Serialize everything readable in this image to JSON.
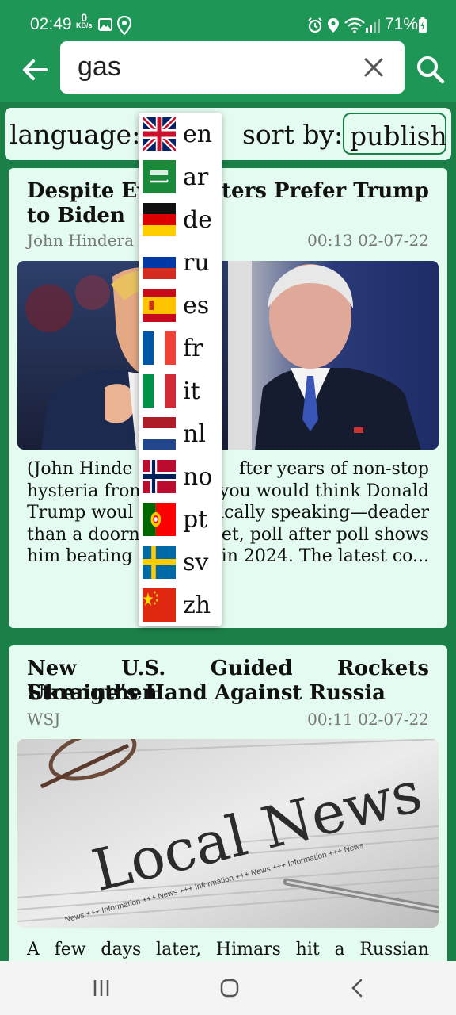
{
  "status_bar": {
    "time": "02:49",
    "net_speed_value": "0",
    "net_speed_unit": "KB/s",
    "battery": "71%",
    "icons": [
      "image-icon",
      "location-icon",
      "alarm-icon",
      "location-icon",
      "wifi-icon",
      "signal-icon",
      "battery-icon"
    ]
  },
  "header": {
    "search_value": "gas",
    "icons": {
      "back": "arrow-left-icon",
      "clear": "close-icon",
      "search": "search-icon"
    }
  },
  "filters": {
    "language_label": "language:",
    "sort_label": "sort by:",
    "sort_value": "publish"
  },
  "language_dropdown": {
    "items": [
      {
        "code": "en",
        "flag": "uk-flag-icon"
      },
      {
        "code": "ar",
        "flag": "saudi-arabia-flag-icon"
      },
      {
        "code": "de",
        "flag": "germany-flag-icon"
      },
      {
        "code": "ru",
        "flag": "russia-flag-icon"
      },
      {
        "code": "es",
        "flag": "spain-flag-icon"
      },
      {
        "code": "fr",
        "flag": "france-flag-icon"
      },
      {
        "code": "it",
        "flag": "italy-flag-icon"
      },
      {
        "code": "nl",
        "flag": "netherlands-flag-icon"
      },
      {
        "code": "no",
        "flag": "norway-flag-icon"
      },
      {
        "code": "pt",
        "flag": "portugal-flag-icon"
      },
      {
        "code": "sv",
        "flag": "sweden-flag-icon"
      },
      {
        "code": "zh",
        "flag": "china-flag-icon"
      }
    ]
  },
  "articles": [
    {
      "title_line1": "Despite Eve",
      "title_line1_right": "Voters Prefer Trump",
      "title_line2": "to Biden",
      "source": "John Hindera",
      "date": "00:13 02-07-22",
      "desc_lines": [
        [
          "(John Hinde",
          "fter years of non-stop"
        ],
        [
          "hysteria fron",
          "you would think Donald"
        ],
        [
          "Trump woul",
          "tically speaking—deader"
        ],
        [
          "than a doorn",
          "et, poll after poll shows"
        ],
        [
          "him beating",
          "in 2024. The latest co..."
        ]
      ]
    },
    {
      "title_line1": "New U.S. Guided Rockets Strengthen",
      "title_line2": "Ukraine’s Hand Against Russia",
      "source": "WSJ",
      "date": "00:11 02-07-22",
      "image_text": "Local News",
      "image_strip": "News +++ Information +++ News +++ Information +++ News +++ Information +++ News",
      "desc": "A few days later, Himars hit a Russian military"
    }
  ],
  "nav_bar": {
    "icons": [
      "recent-apps-icon",
      "home-icon",
      "back-icon"
    ]
  },
  "colors": {
    "primary": "#1e9656",
    "background": "#1b7f48",
    "card": "#e4fbef"
  }
}
